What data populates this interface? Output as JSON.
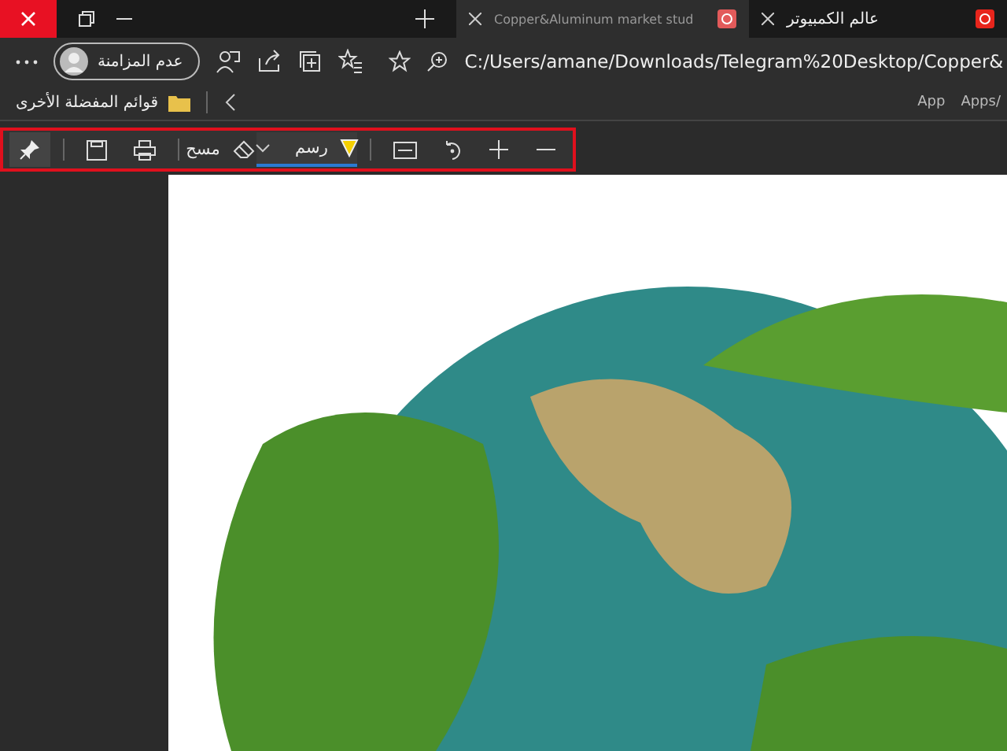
{
  "tabs": [
    {
      "title": "عالم الكمبيوتر",
      "selected": true
    },
    {
      "title": "Copper&Aluminum market stud",
      "selected": false
    }
  ],
  "address_bar": {
    "url": "C:/Users/amane/Downloads/Telegram%20Desktop/Copper&"
  },
  "profile": {
    "label": "عدم المزامنة"
  },
  "bookmarks": {
    "other_favorites": "قوائم المفضلة الأخرى",
    "items": [
      "Apps/",
      "App"
    ]
  },
  "pdf_toolbar": {
    "erase_label": "مسح",
    "draw_label": "رسم",
    "draw_selected": true,
    "highlighted": true
  }
}
